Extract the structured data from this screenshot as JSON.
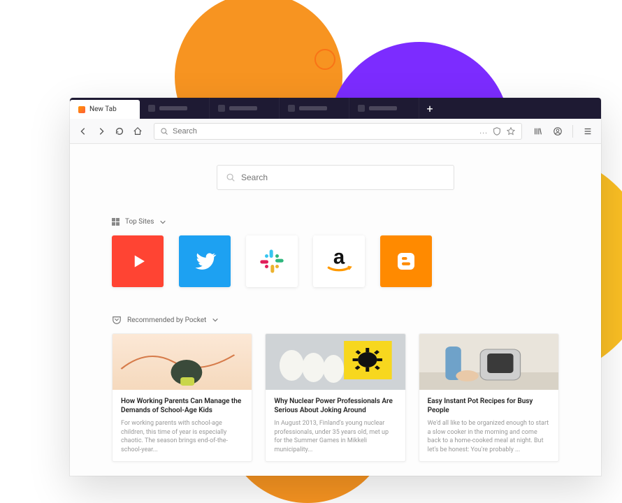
{
  "tab": {
    "active_label": "New Tab"
  },
  "addressbar": {
    "placeholder": "Search",
    "dots": "..."
  },
  "content_search": {
    "placeholder": "Search"
  },
  "top_sites": {
    "header": "Top Sites",
    "tiles": [
      {
        "name": "YouTube",
        "color": "#ff4433"
      },
      {
        "name": "Twitter",
        "color": "#1da1f2"
      },
      {
        "name": "Slack",
        "color": "#ffffff"
      },
      {
        "name": "Amazon",
        "color": "#ffffff"
      },
      {
        "name": "Blogger",
        "color": "#ff8a00"
      }
    ]
  },
  "pocket": {
    "header": "Recommended by Pocket",
    "cards": [
      {
        "title": "How Working Parents Can Manage the Demands of School-Age Kids",
        "excerpt": "For working parents with school-age children, this time of year is especially chaotic. The season brings end-of-the-school-year..."
      },
      {
        "title": "Why Nuclear Power Professionals Are Serious About Joking Around",
        "excerpt": "In August 2013, Finland's young nuclear professionals, under 35 years old, met up for the Summer Games in Mikkeli municipality..."
      },
      {
        "title": "Easy Instant Pot Recipes for Busy People",
        "excerpt": "We'd all like to be organized enough to start a slow cooker in the morning and come back to a home-cooked meal at night. But let's be honest: You're probably ..."
      }
    ]
  }
}
